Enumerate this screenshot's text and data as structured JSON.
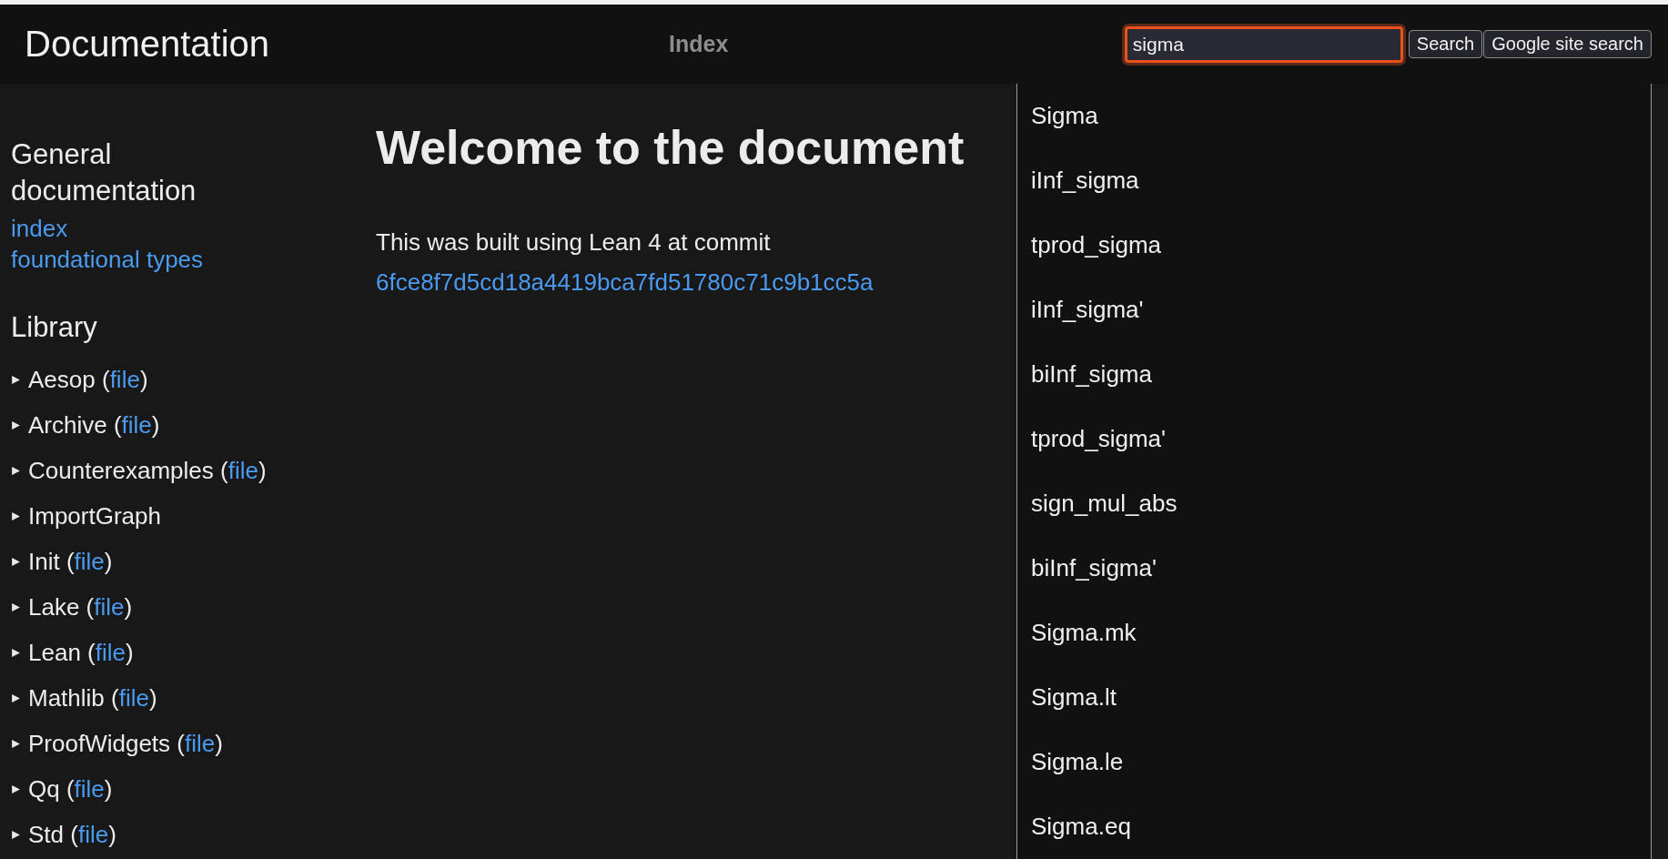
{
  "header": {
    "title": "Documentation",
    "nav_link": "Index",
    "search": {
      "value": "sigma",
      "focused": true
    },
    "buttons": [
      "Search",
      "Google site search"
    ]
  },
  "sidebar": {
    "sections": [
      {
        "heading": "General documentation",
        "links": [
          "index",
          "foundational types"
        ]
      }
    ],
    "library": {
      "heading": "Library",
      "items": [
        {
          "name": "Aesop",
          "paren_open": "(",
          "file_link": "file",
          "paren_close": ")",
          "expanded": false
        },
        {
          "name": "Archive",
          "paren_open": "(",
          "file_link": "file",
          "paren_close": ")",
          "expanded": false
        },
        {
          "name": "Counterexamples",
          "paren_open": "(",
          "file_link": "file",
          "paren_close": ")",
          "expanded": false
        },
        {
          "name": "ImportGraph",
          "expanded": false
        },
        {
          "name": "Init",
          "paren_open": "(",
          "file_link": "file",
          "paren_close": ")",
          "expanded": false
        },
        {
          "name": "Lake",
          "paren_open": "(",
          "file_link": "file",
          "paren_close": ")",
          "expanded": false
        },
        {
          "name": "Lean",
          "paren_open": "(",
          "file_link": "file",
          "paren_close": ")",
          "expanded": false
        },
        {
          "name": "Mathlib",
          "paren_open": "(",
          "file_link": "file",
          "paren_close": ")",
          "expanded": false
        },
        {
          "name": "ProofWidgets",
          "paren_open": "(",
          "file_link": "file",
          "paren_close": ")",
          "expanded": false
        },
        {
          "name": "Qq",
          "paren_open": "(",
          "file_link": "file",
          "paren_close": ")",
          "expanded": false
        },
        {
          "name": "Std",
          "paren_open": "(",
          "file_link": "file",
          "paren_close": ")",
          "expanded": false
        }
      ]
    }
  },
  "main": {
    "heading": "Welcome to the document",
    "paragraph": "This was built using Lean 4 at commit",
    "commit_link": "6fce8f7d5cd18a4419bca7fd51780c71c9b1cc5a"
  },
  "autocomplete": {
    "items": [
      "Sigma",
      "iInf_sigma",
      "tprod_sigma",
      "iInf_sigma'",
      "biInf_sigma",
      "tprod_sigma'",
      "sign_mul_abs",
      "biInf_sigma'",
      "Sigma.mk",
      "Sigma.lt",
      "Sigma.le",
      "Sigma.eq"
    ]
  }
}
